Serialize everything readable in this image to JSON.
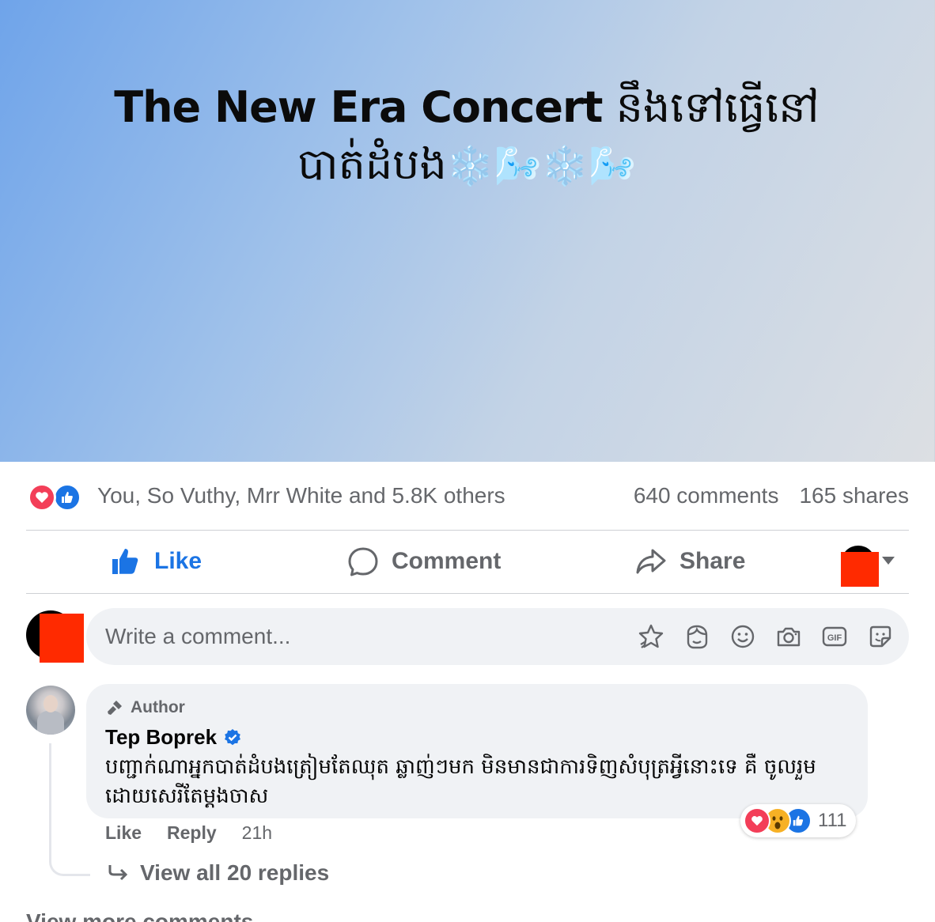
{
  "post": {
    "title_en": "The New Era Concert",
    "title_kh_line1": "នឹងទៅធ្វើនៅ",
    "title_kh_line2": "បាត់ដំបង",
    "title_emoji": "❄️🌬️❄️🌬️"
  },
  "stats": {
    "reactors": "You, So Vuthy, Mrr White and 5.8K others",
    "comments": "640 comments",
    "shares": "165 shares"
  },
  "actions": {
    "like": "Like",
    "comment": "Comment",
    "share": "Share"
  },
  "composer": {
    "placeholder": "Write a comment...",
    "tools": [
      "avatar-sticker-icon",
      "ai-face-icon",
      "emoji-icon",
      "camera-icon",
      "gif-icon",
      "sticker-icon"
    ],
    "gif_label": "GIF"
  },
  "comment": {
    "badge": "Author",
    "author": "Tep Boprek",
    "verified": true,
    "text": "បញ្ជាក់ណាអ្នកបាត់ដំបងត្រៀមតែឈុត ឆ្លាញ់ៗមក មិនមានជាការទិញសំបុត្រអ្វីនោះទេ គឺ ចូលរួមដោយសេរីតែម្តងចាស",
    "reaction_count": "111",
    "like": "Like",
    "reply": "Reply",
    "time": "21h",
    "view_replies": "View all 20 replies"
  },
  "view_more": "View more comments",
  "colors": {
    "accent": "#1b74e4",
    "love": "#f33e58",
    "wow": "#f7b125",
    "muted_text": "#65676b",
    "bubble_bg": "#f0f2f5"
  }
}
